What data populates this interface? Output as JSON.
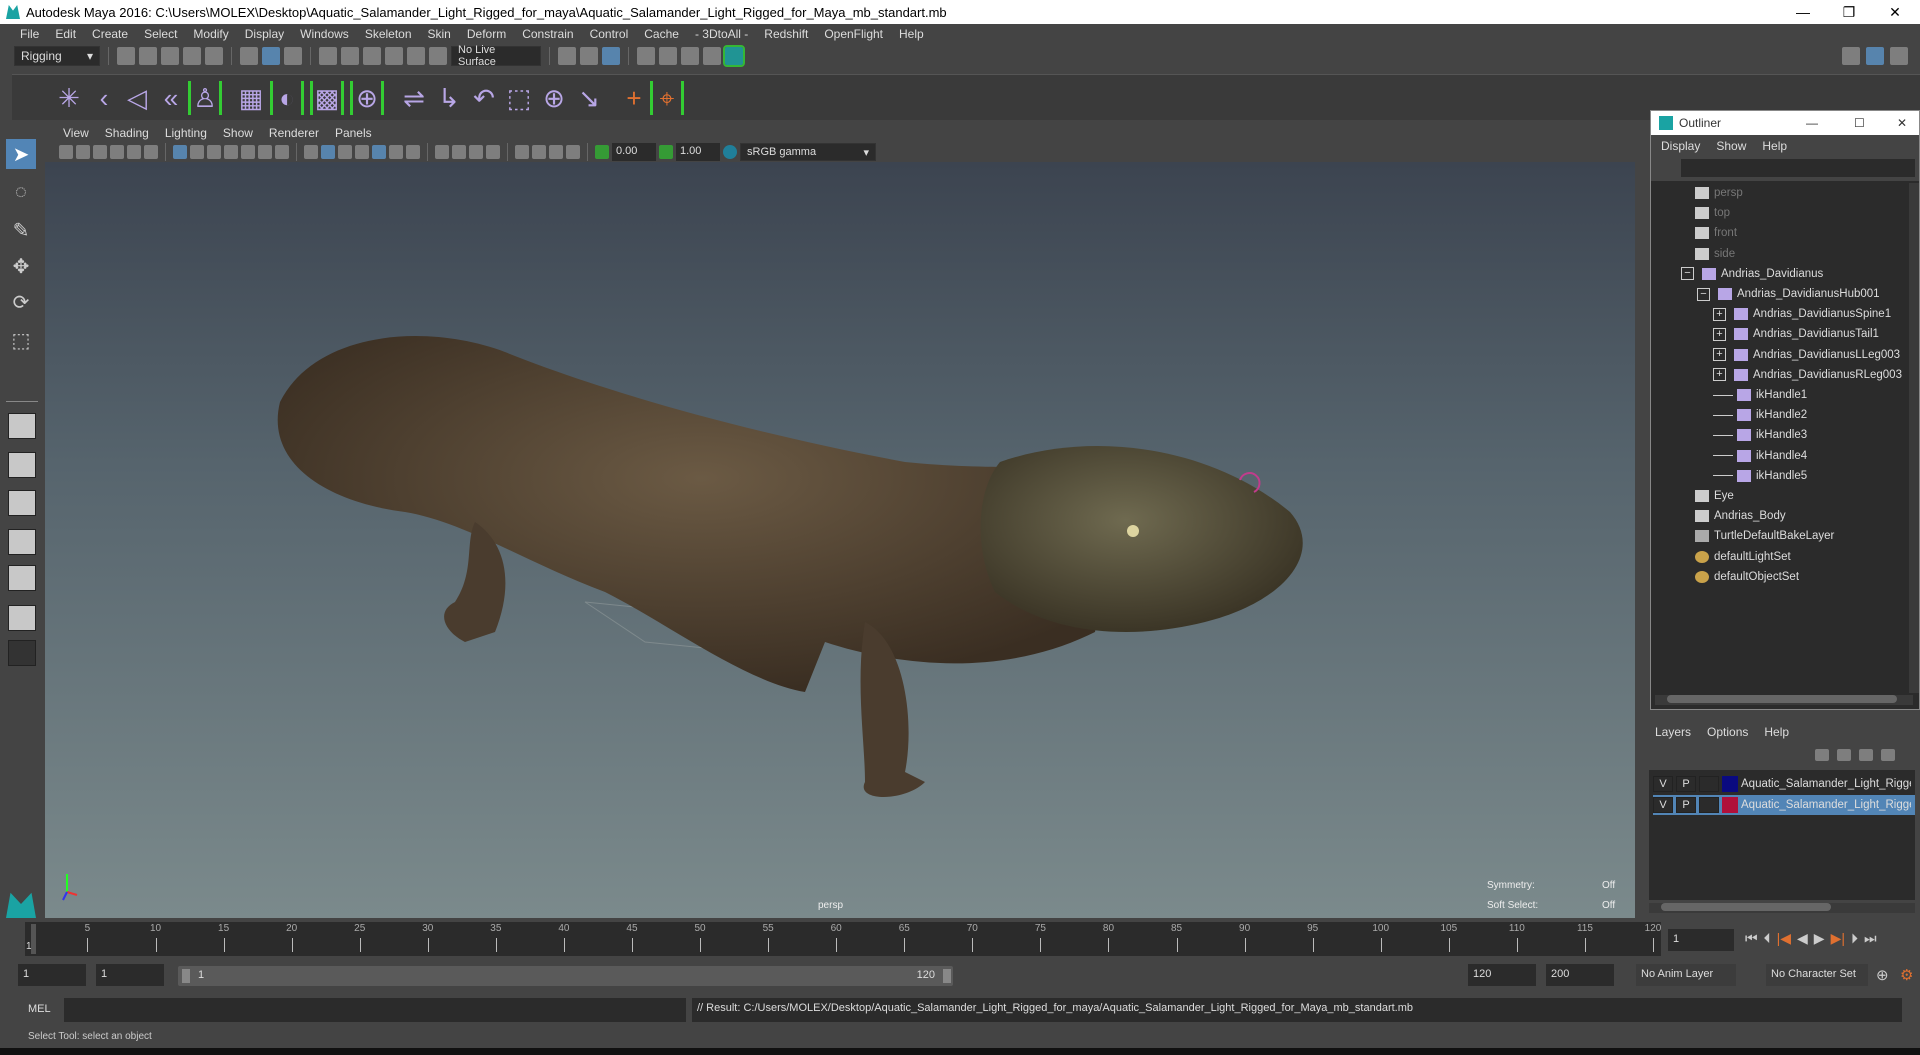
{
  "title": "Autodesk Maya 2016: C:\\Users\\MOLEX\\Desktop\\Aquatic_Salamander_Light_Rigged_for_maya\\Aquatic_Salamander_Light_Rigged_for_Maya_mb_standart.mb",
  "menu": [
    "File",
    "Edit",
    "Create",
    "Select",
    "Modify",
    "Display",
    "Windows",
    "Skeleton",
    "Skin",
    "Deform",
    "Constrain",
    "Control",
    "Cache",
    "- 3DtoAll -",
    "Redshift",
    "OpenFlight",
    "Help"
  ],
  "status": {
    "menuset": "Rigging",
    "live_surface": "No Live Surface"
  },
  "viewport": {
    "menu": [
      "View",
      "Shading",
      "Lighting",
      "Show",
      "Renderer",
      "Panels"
    ],
    "exposure": "0.00",
    "gamma": "1.00",
    "colorspace": "sRGB gamma",
    "camera": "persp",
    "symmetry_label": "Symmetry:",
    "symmetry_value": "Off",
    "soft_label": "Soft Select:",
    "soft_value": "Off"
  },
  "outliner": {
    "title": "Outliner",
    "menu": [
      "Display",
      "Show",
      "Help"
    ],
    "items": [
      {
        "label": "persp",
        "icon": "camera",
        "dim": true
      },
      {
        "label": "top",
        "icon": "camera",
        "dim": true
      },
      {
        "label": "front",
        "icon": "camera",
        "dim": true
      },
      {
        "label": "side",
        "icon": "camera",
        "dim": true
      },
      {
        "label": "Andrias_Davidianus",
        "icon": "joint-root"
      },
      {
        "label": "Andrias_DavidianusHub001",
        "icon": "joint"
      },
      {
        "label": "Andrias_DavidianusSpine1",
        "icon": "joint"
      },
      {
        "label": "Andrias_DavidianusTail1",
        "icon": "joint"
      },
      {
        "label": "Andrias_DavidianusLLeg003",
        "icon": "joint"
      },
      {
        "label": "Andrias_DavidianusRLeg003",
        "icon": "joint"
      },
      {
        "label": "ikHandle1",
        "icon": "ik"
      },
      {
        "label": "ikHandle2",
        "icon": "ik"
      },
      {
        "label": "ikHandle3",
        "icon": "ik"
      },
      {
        "label": "ikHandle4",
        "icon": "ik"
      },
      {
        "label": "ikHandle5",
        "icon": "ik"
      },
      {
        "label": "Eye",
        "icon": "mesh"
      },
      {
        "label": "Andrias_Body",
        "icon": "mesh"
      },
      {
        "label": "TurtleDefaultBakeLayer",
        "icon": "bake"
      },
      {
        "label": "defaultLightSet",
        "icon": "set"
      },
      {
        "label": "defaultObjectSet",
        "icon": "set"
      }
    ]
  },
  "layers": {
    "menu": [
      "Layers",
      "Options",
      "Help"
    ],
    "rows": [
      {
        "v": "V",
        "p": "P",
        "color": "#0a0a80",
        "name": "Aquatic_Salamander_Light_Rigged",
        "selected": false
      },
      {
        "v": "V",
        "p": "P",
        "color": "#b0103a",
        "name": "Aquatic_Salamander_Light_Rigged",
        "selected": true
      }
    ]
  },
  "timeline": {
    "start": 1,
    "end": 120,
    "step": 5,
    "current": "1"
  },
  "range": {
    "start": "1",
    "inner_start": "1",
    "slider_start": "1",
    "slider_end": "120",
    "end": "120",
    "max": "200",
    "anim_layer": "No Anim Layer",
    "char_set": "No Character Set"
  },
  "cmd": {
    "lang": "MEL",
    "result": "// Result: C:/Users/MOLEX/Desktop/Aquatic_Salamander_Light_Rigged_for_maya/Aquatic_Salamander_Light_Rigged_for_Maya_mb_standart.mb"
  },
  "help": "Select Tool: select an object"
}
